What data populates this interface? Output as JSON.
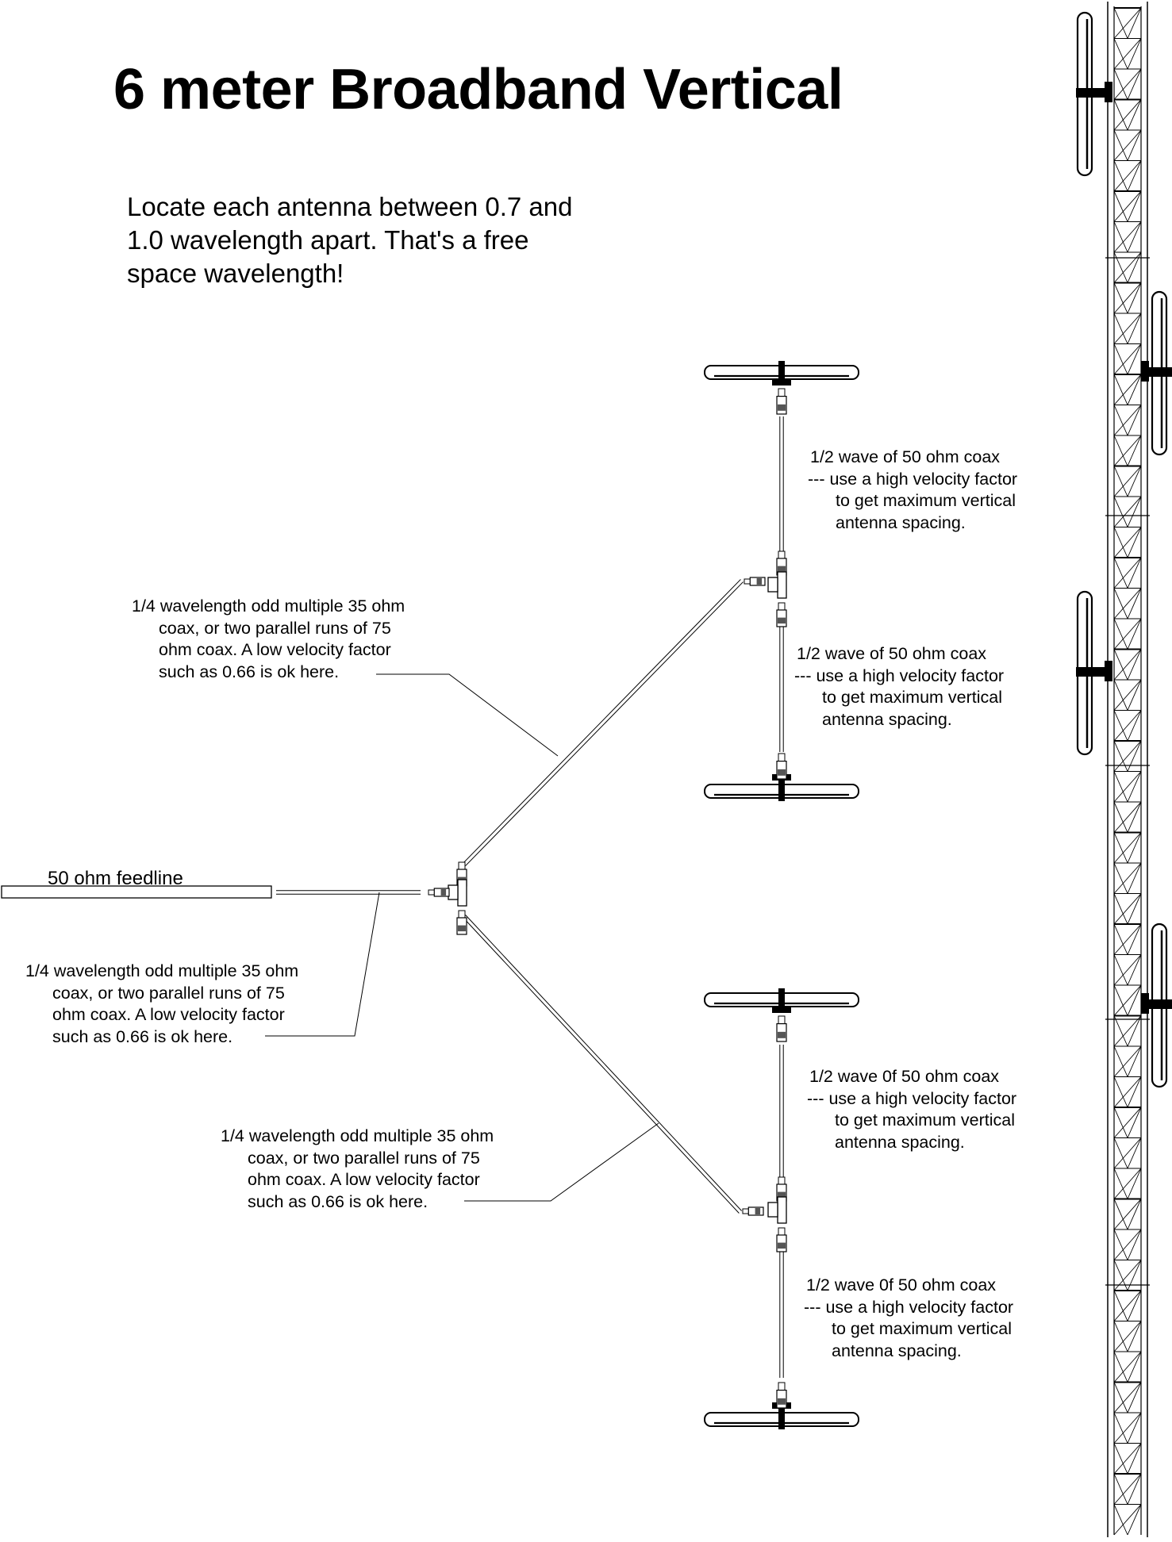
{
  "diagram": {
    "title": "6 meter Broadband Vertical",
    "note": {
      "lines": [
        "Locate each antenna between 0.7 and",
        "1.0 wavelength apart.  That's a free",
        "space wavelength!"
      ]
    },
    "feedline_label": "50 ohm feedline",
    "quarter_wave_labels": [
      {
        "id": "upper",
        "lines": [
          "1/4 wavelength odd multiple 35 ohm",
          "coax, or two parallel runs of 75",
          "ohm coax.  A low velocity factor",
          "such as 0.66 is ok here."
        ]
      },
      {
        "id": "feed",
        "lines": [
          "1/4 wavelength odd multiple 35 ohm",
          "coax, or two parallel runs of 75",
          "ohm coax.  A low velocity factor",
          "such as 0.66 is ok here."
        ]
      },
      {
        "id": "lower",
        "lines": [
          "1/4 wavelength odd multiple 35 ohm",
          "coax, or two parallel runs of 75",
          "ohm coax.  A low velocity factor",
          "such as 0.66 is ok here."
        ]
      }
    ],
    "half_wave_labels": [
      {
        "id": "pair1-top",
        "lines": [
          "1/2 wave of 50 ohm coax",
          "--- use a high velocity factor",
          "to get maximum vertical",
          "antenna spacing."
        ]
      },
      {
        "id": "pair1-bottom",
        "lines": [
          "1/2 wave of 50 ohm coax",
          "--- use a high velocity factor",
          "to get maximum vertical",
          "antenna spacing."
        ]
      },
      {
        "id": "pair2-top",
        "lines": [
          "1/2 wave 0f 50 ohm coax",
          "--- use a high velocity factor",
          "to get maximum vertical",
          "antenna spacing."
        ]
      },
      {
        "id": "pair2-bottom",
        "lines": [
          "1/2 wave 0f 50 ohm coax",
          "--- use a high velocity factor",
          "to get maximum vertical",
          "antenna spacing."
        ]
      }
    ],
    "components": {
      "dipole_antennas_count": 4,
      "tower_mounted_antennas_count": 4,
      "tee_connectors_count": 3,
      "icons": [
        "dipole-antenna-icon",
        "tee-connector-icon",
        "coax-plug-icon",
        "lattice-tower-icon"
      ]
    },
    "colors": {
      "ink": "#000000",
      "background": "#ffffff"
    }
  }
}
